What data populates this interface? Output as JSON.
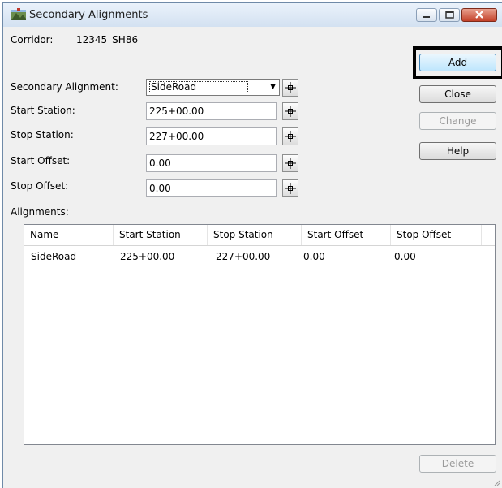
{
  "window": {
    "title": "Secondary Alignments"
  },
  "form": {
    "corridor_label": "Corridor:",
    "corridor_value": "12345_SH86",
    "secondary_alignment_label": "Secondary Alignment:",
    "secondary_alignment_value": "SideRoad",
    "start_station_label": "Start Station:",
    "start_station_value": "225+00.00",
    "stop_station_label": "Stop Station:",
    "stop_station_value": "227+00.00",
    "start_offset_label": "Start Offset:",
    "start_offset_value": "0.00",
    "stop_offset_label": "Stop Offset:",
    "stop_offset_value": "0.00",
    "alignments_label": "Alignments:"
  },
  "buttons": {
    "add": "Add",
    "close": "Close",
    "change": "Change",
    "help": "Help",
    "delete": "Delete"
  },
  "table": {
    "columns": [
      "Name",
      "Start Station",
      "Stop Station",
      "Start Offset",
      "Stop Offset"
    ],
    "rows": [
      [
        "SideRoad",
        "225+00.00",
        "227+00.00",
        "0.00",
        "0.00"
      ]
    ]
  },
  "icons": [
    "app-icon",
    "minimize-icon",
    "maximize-icon",
    "close-icon",
    "locate-icon",
    "dropdown-arrow-icon",
    "resize-grip-icon"
  ]
}
